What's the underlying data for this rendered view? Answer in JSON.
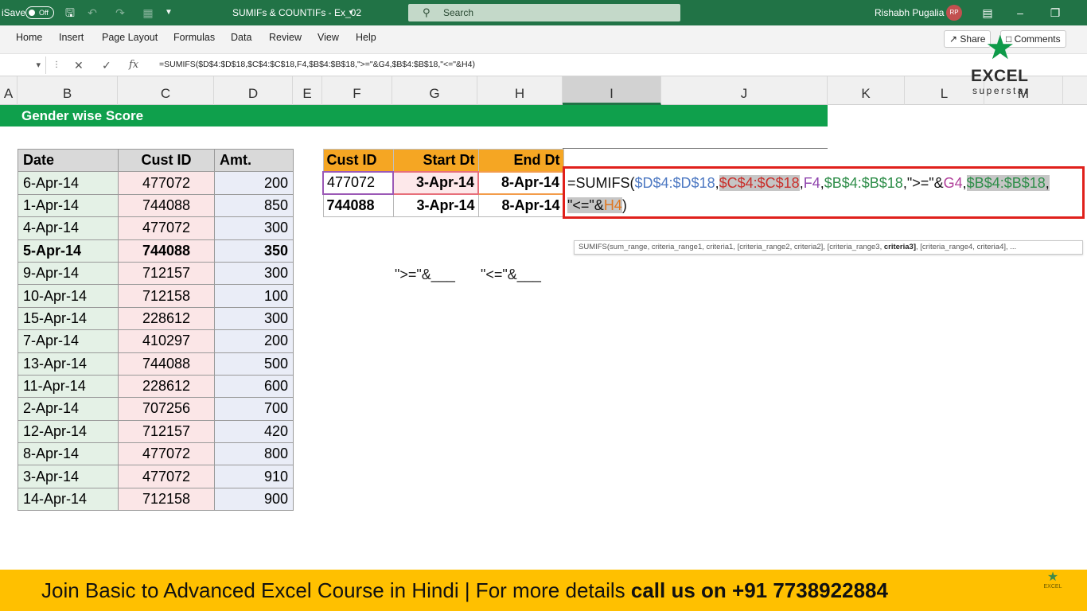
{
  "titlebar": {
    "autosave_label": "iSave",
    "autosave_state": "Off",
    "doc_title": "SUMIFs & COUNTIFs - Ex_02",
    "search_placeholder": "Search",
    "user_name": "Rishabh Pugalia",
    "user_initials": "RP"
  },
  "ribbon": {
    "tabs": [
      "Home",
      "Insert",
      "Page Layout",
      "Formulas",
      "Data",
      "Review",
      "View",
      "Help"
    ],
    "share_label": "Share",
    "comments_label": "Comments"
  },
  "formula_bar": {
    "fx_label": "fx",
    "formula": "=SUMIFS($D$4:$D$18,$C$4:$C$18,F4,$B$4:$B$18,\">=\"&G4,$B$4:$B$18,\"<=\"&H4)"
  },
  "columns": [
    "A",
    "B",
    "C",
    "D",
    "E",
    "F",
    "G",
    "H",
    "I",
    "J",
    "K",
    "L",
    "M"
  ],
  "selected_column": "I",
  "sheet": {
    "banner_title": "Gender wise Score",
    "data_table": {
      "headers": [
        "Date",
        "Cust ID",
        "Amt."
      ],
      "rows": [
        [
          "6-Apr-14",
          "477072",
          "200"
        ],
        [
          "1-Apr-14",
          "744088",
          "850"
        ],
        [
          "4-Apr-14",
          "477072",
          "300"
        ],
        [
          "5-Apr-14",
          "744088",
          "350"
        ],
        [
          "9-Apr-14",
          "712157",
          "300"
        ],
        [
          "10-Apr-14",
          "712158",
          "100"
        ],
        [
          "15-Apr-14",
          "228612",
          "300"
        ],
        [
          "7-Apr-14",
          "410297",
          "200"
        ],
        [
          "13-Apr-14",
          "744088",
          "500"
        ],
        [
          "11-Apr-14",
          "228612",
          "600"
        ],
        [
          "2-Apr-14",
          "707256",
          "700"
        ],
        [
          "12-Apr-14",
          "712157",
          "420"
        ],
        [
          "8-Apr-14",
          "477072",
          "800"
        ],
        [
          "3-Apr-14",
          "477072",
          "910"
        ],
        [
          "14-Apr-14",
          "712158",
          "900"
        ]
      ]
    },
    "criteria_table": {
      "headers": [
        "Cust ID",
        "Start Dt",
        "End Dt"
      ],
      "rows": [
        [
          "477072",
          "3-Apr-14",
          "8-Apr-14"
        ],
        [
          "744088",
          "3-Apr-14",
          "8-Apr-14"
        ]
      ]
    },
    "edit_formula": {
      "line1": [
        {
          "t": "=SUMIFS(",
          "c": "f-black"
        },
        {
          "t": "$D$4:$D$18",
          "c": "f-blue"
        },
        {
          "t": ",",
          "c": "f-black"
        },
        {
          "t": "$C$4:$C$18",
          "c": "f-red hl"
        },
        {
          "t": ",",
          "c": "f-black"
        },
        {
          "t": "F4",
          "c": "f-purple"
        },
        {
          "t": ",",
          "c": "f-black"
        },
        {
          "t": "$B$4:$B$18",
          "c": "f-green"
        },
        {
          "t": ",\">=\"&",
          "c": "f-black"
        },
        {
          "t": "G4",
          "c": "f-mag"
        },
        {
          "t": ",",
          "c": "f-black"
        },
        {
          "t": "$B$4:$B$18",
          "c": "f-green hl"
        },
        {
          "t": ",",
          "c": "f-black hl"
        }
      ],
      "line2": [
        {
          "t": "\"<=\"&",
          "c": "f-black hl"
        },
        {
          "t": "H4",
          "c": "f-orange hl"
        },
        {
          "t": ")",
          "c": "f-black"
        }
      ]
    },
    "tooltip": {
      "before": "SUMIFS(sum_range, criteria_range1, criteria1, [criteria_range2, criteria2], [criteria_range3, ",
      "bold": "criteria3]",
      "after": ", [criteria_range4, criteria4], ..."
    },
    "hints": [
      "\">=\"&___",
      "\"<=\"&___"
    ]
  },
  "logo": {
    "word1": "EXCEL",
    "word2": "superstar"
  },
  "promo": {
    "text": "Join Basic to Advanced Excel Course in Hindi | For more details ",
    "bold": "call us on +91 7738922884"
  },
  "colors": {
    "excel_green": "#217346",
    "banner_green": "#0fa04c",
    "criteria_orange": "#f5a623",
    "promo_yellow": "#ffc000",
    "edit_border_red": "#e0201b"
  },
  "icons": [
    "save-icon",
    "undo-icon",
    "redo-icon",
    "customize-icon",
    "search-icon",
    "ribbon-display-icon",
    "minimize-icon",
    "share-icon",
    "comments-icon",
    "cancel-icon",
    "enter-icon",
    "star-icon"
  ]
}
